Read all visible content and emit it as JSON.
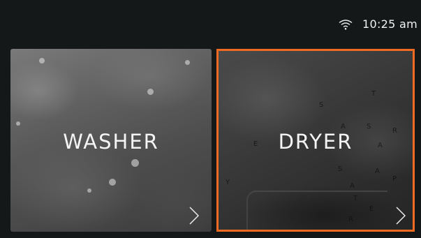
{
  "status": {
    "time": "10:25 am",
    "wifi_icon": "wifi-icon"
  },
  "tiles": [
    {
      "label": "WASHER",
      "selected": false,
      "icon": "chevron-right-icon"
    },
    {
      "label": "DRYER",
      "selected": true,
      "icon": "chevron-right-icon"
    }
  ],
  "colors": {
    "background": "#141819",
    "selected_border": "#f06a21",
    "text": "#f4f4f4"
  }
}
